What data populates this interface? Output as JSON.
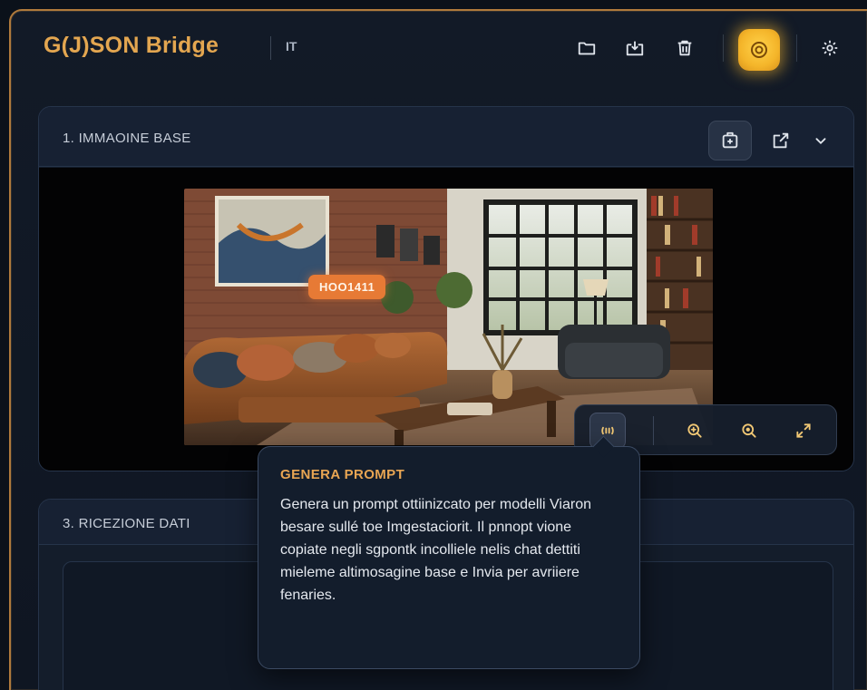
{
  "header": {
    "brand": "G(J)SON Bridge",
    "lang": "IT",
    "icons": [
      "folder-icon",
      "download-icon",
      "trash-icon",
      "prompt-active-icon",
      "settings-icon"
    ],
    "accent": "#f4b52a"
  },
  "section1": {
    "title": "1. IMMAOINE BASE",
    "photo_badge": "HOO1411",
    "header_icons": [
      "add-image-icon",
      "export-icon",
      "chevron-down-icon"
    ],
    "toolbar_icons": [
      "generate-prompt-icon",
      "zoom-in-icon",
      "zoom-reset-icon",
      "fullscreen-icon"
    ]
  },
  "section3": {
    "title": "3. RICEZIONE DATI"
  },
  "tooltip": {
    "title": "GENERA PROMPT",
    "body": "Genera un prompt ottiinizcato per modelli Viaron besare sullé toe Imgestaciorit. Il pnnopt vione copiate negli sgpontk incolliele nelis chat dettiti mieleme altimosagine base e Invia per avriiere fenaries."
  }
}
